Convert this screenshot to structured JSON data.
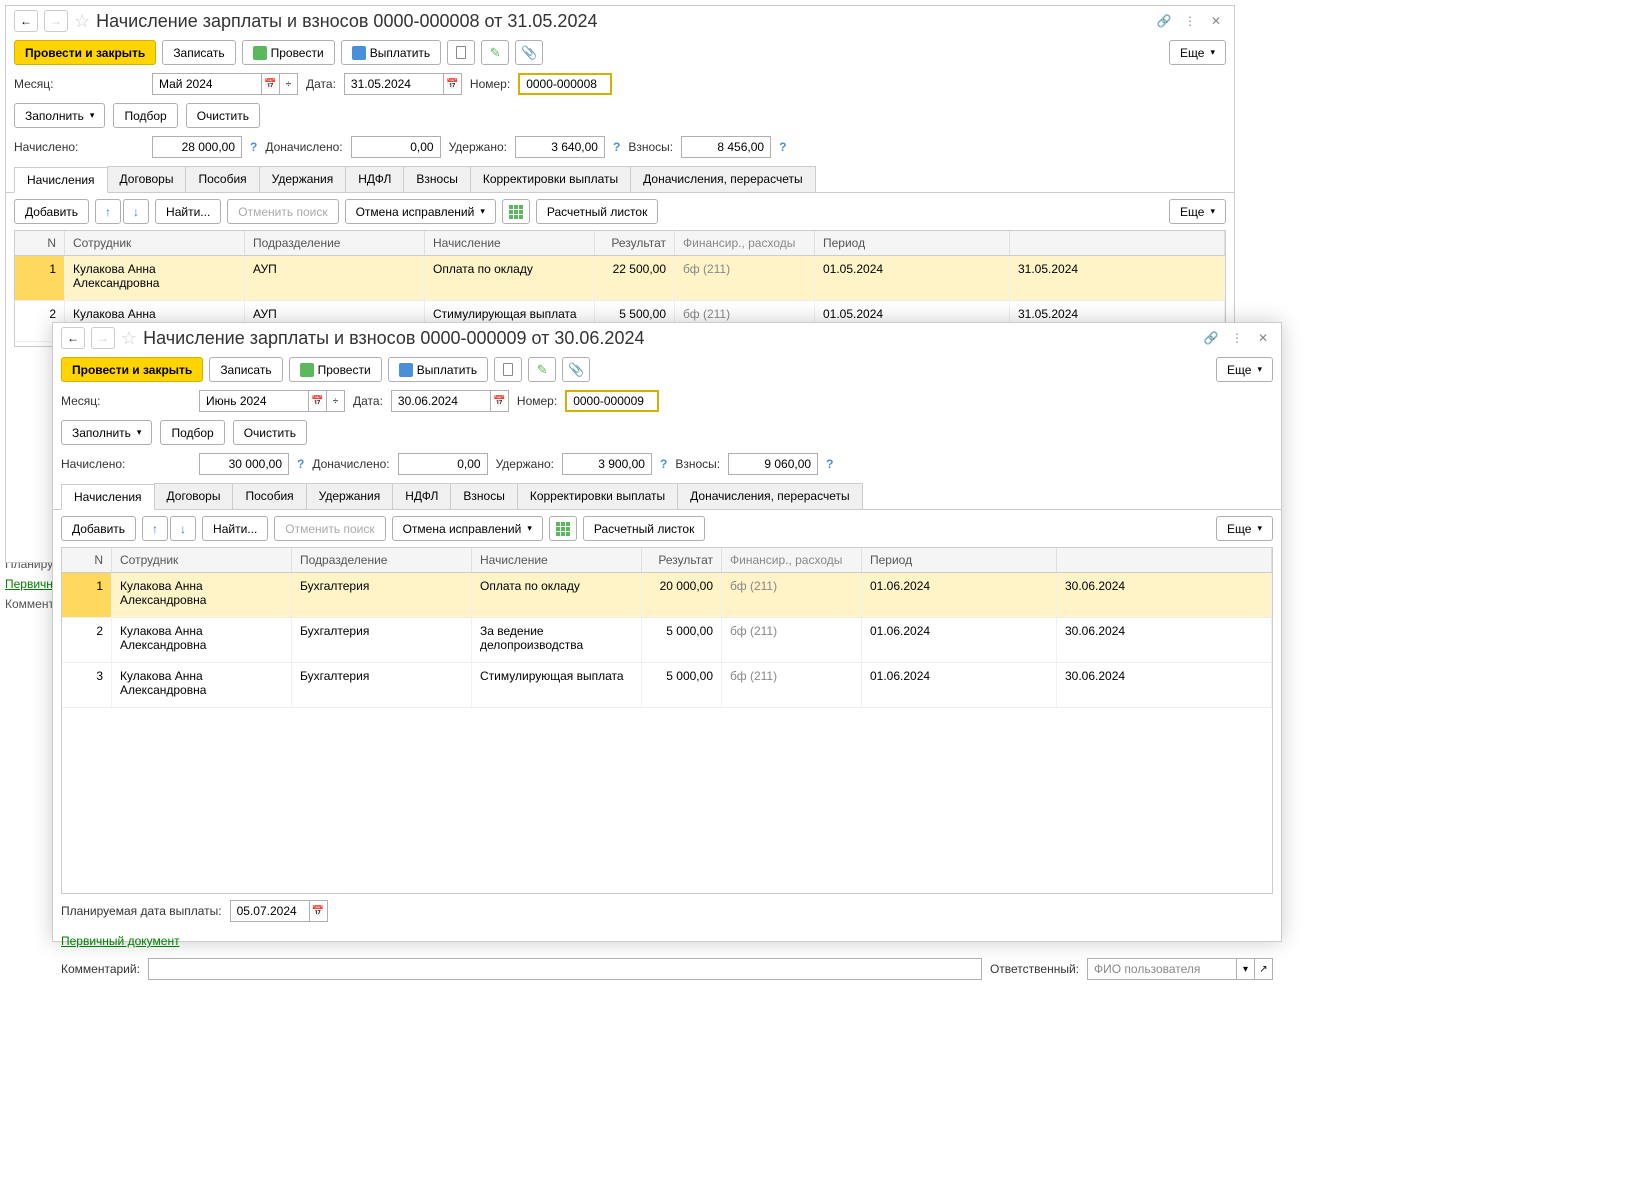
{
  "common": {
    "buttons": {
      "post_close": "Провести и закрыть",
      "save": "Записать",
      "post": "Провести",
      "pay": "Выплатить",
      "more": "Еще",
      "fill": "Заполнить",
      "pick": "Подбор",
      "clear": "Очистить",
      "add": "Добавить",
      "find": "Найти...",
      "cancel_search": "Отменить поиск",
      "cancel_corrections": "Отмена исправлений",
      "payslip": "Расчетный листок"
    },
    "labels": {
      "month": "Месяц:",
      "date": "Дата:",
      "number": "Номер:",
      "accrued": "Начислено:",
      "extra_accrued": "Доначислено:",
      "withheld": "Удержано:",
      "contributions": "Взносы:",
      "planned_date": "Планируемая дата выплаты:",
      "primary_doc": "Первичный документ",
      "comment": "Комментарий:",
      "responsible": "Ответственный:",
      "responsible_ph": "ФИО пользователя"
    },
    "tabs": [
      "Начисления",
      "Договоры",
      "Пособия",
      "Удержания",
      "НДФЛ",
      "Взносы",
      "Корректировки выплаты",
      "Доначисления, перерасчеты"
    ],
    "table_headers": {
      "n": "N",
      "employee": "Сотрудник",
      "department": "Подразделение",
      "accrual": "Начисление",
      "result": "Результат",
      "financing": "Финансир., расходы",
      "period": "Период"
    }
  },
  "side": {
    "l1": "Планиру",
    "l2": "Первичн",
    "l3": "Коммент"
  },
  "doc1": {
    "title": "Начисление зарплаты и взносов 0000-000008 от 31.05.2024",
    "month": "Май 2024",
    "date": "31.05.2024",
    "number": "0000-000008",
    "sums": {
      "accrued": "28 000,00",
      "extra": "0,00",
      "withheld": "3 640,00",
      "contrib": "8 456,00"
    },
    "rows": [
      {
        "n": "1",
        "emp": "Кулакова Анна Александровна",
        "dep": "АУП",
        "acc": "Оплата по окладу",
        "res": "22 500,00",
        "fin": "бф (211)",
        "pfrom": "01.05.2024",
        "pto": "31.05.2024"
      },
      {
        "n": "2",
        "emp": "Кулакова Анна Александровна",
        "dep": "АУП",
        "acc": "Стимулирующая выплата",
        "res": "5 500,00",
        "fin": "бф (211)",
        "pfrom": "01.05.2024",
        "pto": "31.05.2024"
      }
    ]
  },
  "doc2": {
    "title": "Начисление зарплаты и взносов 0000-000009 от 30.06.2024",
    "month": "Июнь 2024",
    "date": "30.06.2024",
    "number": "0000-000009",
    "sums": {
      "accrued": "30 000,00",
      "extra": "0,00",
      "withheld": "3 900,00",
      "contrib": "9 060,00"
    },
    "rows": [
      {
        "n": "1",
        "emp": "Кулакова Анна Александровна",
        "dep": "Бухгалтерия",
        "acc": "Оплата по окладу",
        "res": "20 000,00",
        "fin": "бф (211)",
        "pfrom": "01.06.2024",
        "pto": "30.06.2024"
      },
      {
        "n": "2",
        "emp": "Кулакова Анна Александровна",
        "dep": "Бухгалтерия",
        "acc": "За ведение делопроизводства",
        "res": "5 000,00",
        "fin": "бф (211)",
        "pfrom": "01.06.2024",
        "pto": "30.06.2024"
      },
      {
        "n": "3",
        "emp": "Кулакова Анна Александровна",
        "dep": "Бухгалтерия",
        "acc": "Стимулирующая выплата",
        "res": "5 000,00",
        "fin": "бф (211)",
        "pfrom": "01.06.2024",
        "pto": "30.06.2024"
      }
    ],
    "planned_date": "05.07.2024"
  }
}
